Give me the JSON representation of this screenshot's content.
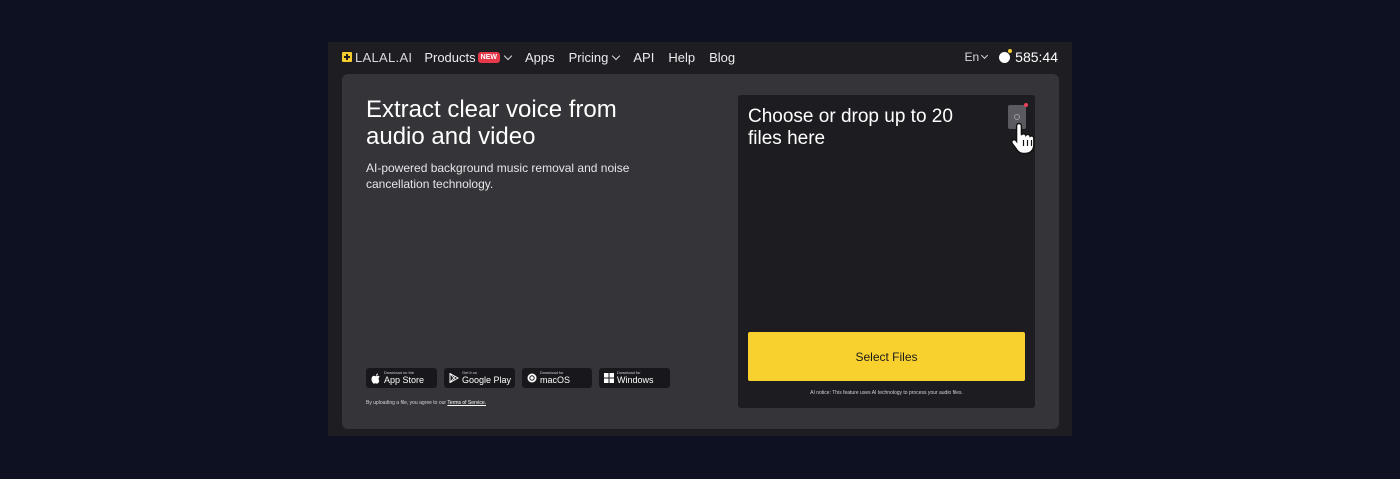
{
  "nav": {
    "logo": "LALAL.AI",
    "items": [
      {
        "label": "Products",
        "badge": "NEW",
        "dropdown": true
      },
      {
        "label": "Apps",
        "dropdown": false
      },
      {
        "label": "Pricing",
        "dropdown": true
      },
      {
        "label": "API",
        "dropdown": false
      },
      {
        "label": "Help",
        "dropdown": false
      },
      {
        "label": "Blog",
        "dropdown": false
      }
    ],
    "language": "En",
    "timer": "585:44"
  },
  "hero": {
    "title": "Extract clear voice from audio and video",
    "subtitle": "AI-powered background music removal and noise cancellation technology."
  },
  "stores": [
    {
      "small": "Download on the",
      "big": "App Store",
      "icon": "apple-icon"
    },
    {
      "small": "Get it on",
      "big": "Google Play",
      "icon": "google-play-icon"
    },
    {
      "small": "Download for",
      "big": "macOS",
      "icon": "macos-icon"
    },
    {
      "small": "Download for",
      "big": "Windows",
      "icon": "windows-icon"
    }
  ],
  "terms": {
    "prefix": "By uploading a file, you agree to our",
    "link": "Terms of Service."
  },
  "upload": {
    "title": "Choose or drop up to 20 files here",
    "button": "Select Files",
    "notice": "AI notice: This feature uses AI technology to process your audio files."
  },
  "colors": {
    "background": "#0e1122",
    "accent": "#f8d12f",
    "card": "#353438",
    "dropzone": "#1d1c20",
    "badge": "#e63a4a"
  }
}
